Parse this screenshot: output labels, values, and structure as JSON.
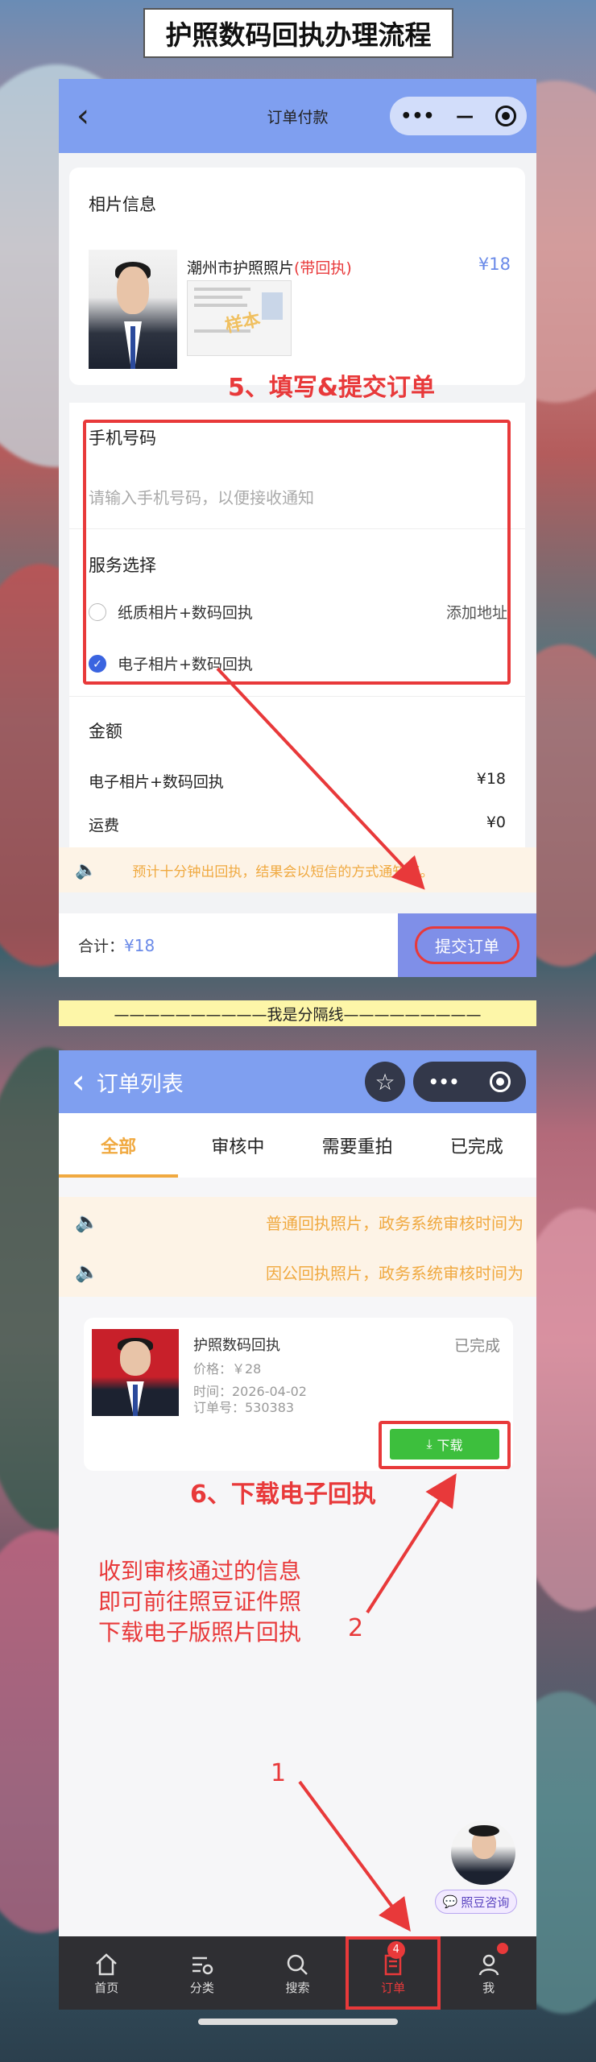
{
  "page_title": "护照数码回执办理流程",
  "order_pay": {
    "header": {
      "title": "订单付款",
      "capsule_more": "•••",
      "capsule_min": "—"
    },
    "photo_info": {
      "title": "相片信息",
      "product_name": "潮州市护照照片",
      "product_tag": "(带回执)",
      "price": "¥18",
      "sample_label": "样本"
    },
    "step5_label": "5、填写&提交订单",
    "phone": {
      "label": "手机号码",
      "placeholder": "请输入手机号码，以便接收通知"
    },
    "service": {
      "label": "服务选择",
      "option1": "纸质相片+数码回执",
      "option1_action": "添加地址",
      "option2": "电子相片+数码回执",
      "selected": 2
    },
    "amount": {
      "title": "金额",
      "item_label": "电子相片+数码回执",
      "item_value": "¥18",
      "shipping_label": "运费",
      "shipping_value": "¥0"
    },
    "notice": "预计十分钟出回执，结果会以短信的方式通知您。",
    "footer": {
      "total_label": "合计：",
      "total_value": "¥18",
      "submit_label": "提交订单"
    }
  },
  "separator": "——————————我是分隔线—————————",
  "order_list": {
    "header": {
      "title": "订单列表",
      "capsule_more": "•••"
    },
    "tabs": [
      "全部",
      "审核中",
      "需要重拍",
      "已完成"
    ],
    "active_tab": 0,
    "notices": [
      "普通回执照片，政务系统审核时间为",
      "因公回执照片，政务系统审核时间为"
    ],
    "order": {
      "name": "护照数码回执",
      "status": "已完成",
      "price": "价格：￥28",
      "time": "时间：2026-04-02",
      "order_no": "订单号：530383",
      "download_label": "下载"
    },
    "step6_label": "6、下载电子回执",
    "annotation_lines": [
      "收到审核通过的信息",
      "即可前往照豆证件照",
      "下载电子版照片回执"
    ],
    "marker_2": "2",
    "marker_1": "1",
    "consult_label": "照豆咨询",
    "tabbar": {
      "items": [
        {
          "label": "首页",
          "icon": "home-icon"
        },
        {
          "label": "分类",
          "icon": "category-icon"
        },
        {
          "label": "搜索",
          "icon": "search-icon"
        },
        {
          "label": "订单",
          "icon": "order-icon",
          "badge": "4"
        },
        {
          "label": "我",
          "icon": "user-icon"
        }
      ]
    }
  },
  "colors": {
    "accent": "#7f9ff0",
    "red": "#e8393a",
    "orange": "#f0a940",
    "green": "#3dbf3d",
    "submit": "#7f8fe8"
  }
}
